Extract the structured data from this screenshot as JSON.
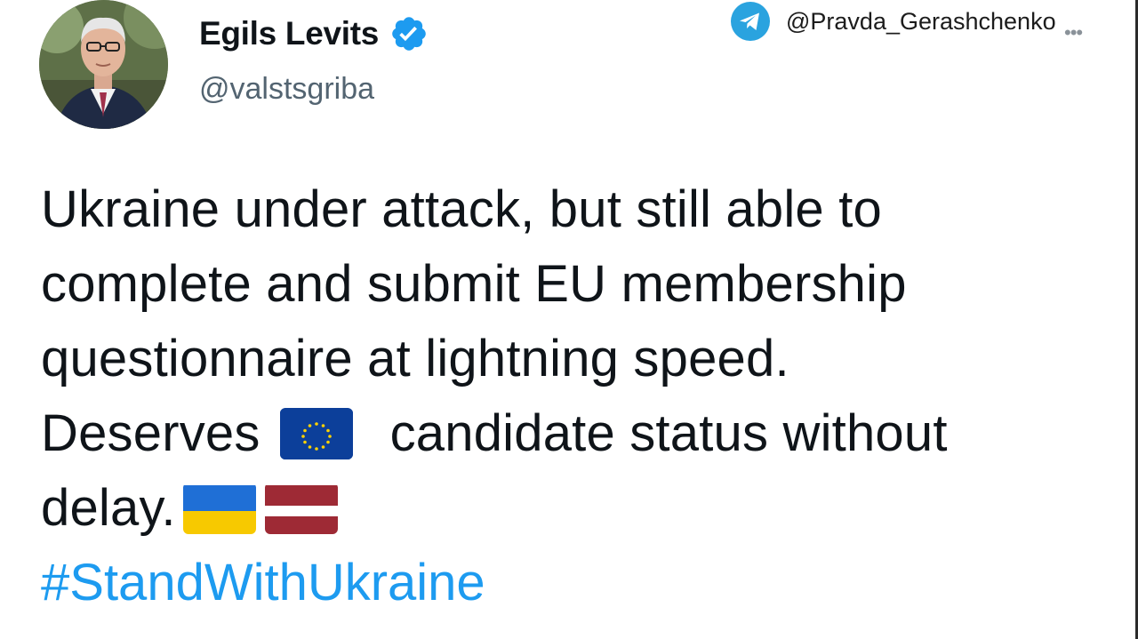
{
  "author": {
    "display_name": "Egils Levits",
    "handle": "@valstsgriba",
    "verified_icon": "verified-badge-icon",
    "avatar": "profile-photo"
  },
  "watermark": {
    "text": "@Pravda_Gerashchenko",
    "icon": "telegram-icon"
  },
  "more_icon": "more-options-icon",
  "tweet": {
    "line1": "Ukraine under attack, but still able to",
    "line2": "complete and submit EU membership",
    "line3": "questionnaire at lightning speed.",
    "line4_before": "Deserves",
    "line4_after": "candidate status without",
    "line5": "delay.",
    "hashtag": "#StandWithUkraine",
    "emoji": [
      "eu-flag-icon",
      "ukraine-flag-icon",
      "latvia-flag-icon"
    ]
  },
  "colors": {
    "link": "#1d9bf0",
    "handle": "#536471",
    "verified": "#1d9bf0",
    "telegram": "#2aa3df"
  }
}
